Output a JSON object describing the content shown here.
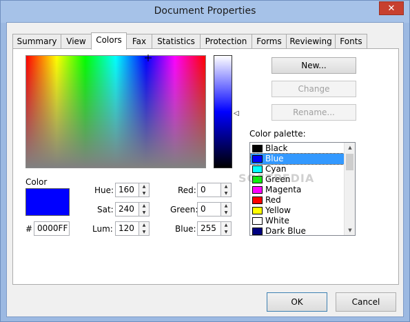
{
  "window": {
    "title": "Document Properties",
    "close_label": "✕"
  },
  "tabs": [
    {
      "label": "Summary"
    },
    {
      "label": "View"
    },
    {
      "label": "Colors"
    },
    {
      "label": "Fax"
    },
    {
      "label": "Statistics"
    },
    {
      "label": "Protection"
    },
    {
      "label": "Forms"
    },
    {
      "label": "Reviewing"
    },
    {
      "label": "Fonts"
    }
  ],
  "buttons": {
    "new": "New...",
    "change": "Change",
    "rename": "Rename...",
    "ok": "OK",
    "cancel": "Cancel"
  },
  "color": {
    "label": "Color",
    "hash": "#",
    "hex": "0000FF",
    "swatch_color": "#0000FF",
    "hue_label": "Hue:",
    "hue": "160",
    "sat_label": "Sat:",
    "sat": "240",
    "lum_label": "Lum:",
    "lum": "120",
    "red_label": "Red:",
    "red": "0",
    "green_label": "Green:",
    "green": "0",
    "blue_label": "Blue:",
    "blue": "255"
  },
  "palette": {
    "label": "Color palette:",
    "items": [
      {
        "name": "Black",
        "color": "#000000"
      },
      {
        "name": "Blue",
        "color": "#0000FF",
        "selected": true
      },
      {
        "name": "Cyan",
        "color": "#00FFFF"
      },
      {
        "name": "Green",
        "color": "#00FF00"
      },
      {
        "name": "Magenta",
        "color": "#FF00FF"
      },
      {
        "name": "Red",
        "color": "#FF0000"
      },
      {
        "name": "Yellow",
        "color": "#FFFF00"
      },
      {
        "name": "White",
        "color": "#FFFFFF"
      },
      {
        "name": "Dark Blue",
        "color": "#000080"
      }
    ]
  },
  "watermark": "SOFTPEDIA"
}
